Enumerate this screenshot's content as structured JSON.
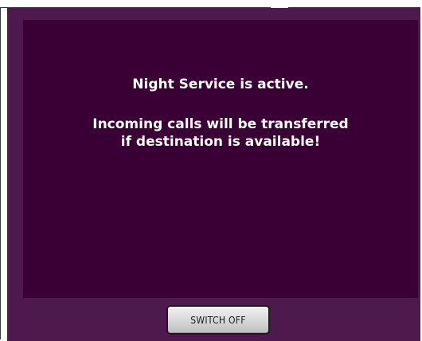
{
  "message": {
    "line1": "Night Service is active.",
    "line2": "Incoming calls will be transferred",
    "line3": "if destination is available!"
  },
  "controls": {
    "switch_off_label": "SWITCH OFF"
  },
  "colors": {
    "outer_panel": "#4e1a4d",
    "inner_panel": "#3a0036",
    "text": "#ffffff"
  }
}
